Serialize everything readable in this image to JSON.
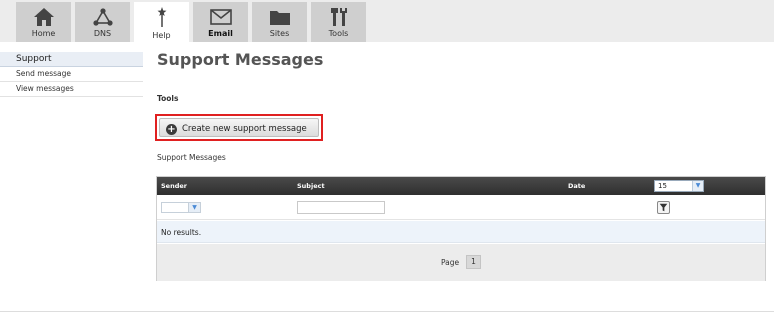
{
  "nav": {
    "tabs": [
      {
        "label": "Home",
        "icon": "home-icon"
      },
      {
        "label": "DNS",
        "icon": "network-icon"
      },
      {
        "label": "Help",
        "icon": "wand-icon"
      },
      {
        "label": "Email",
        "icon": "envelope-icon"
      },
      {
        "label": "Sites",
        "icon": "folder-icon"
      },
      {
        "label": "Tools",
        "icon": "tools-icon"
      }
    ],
    "active_tab": "Help"
  },
  "sidebar": {
    "header": "Support",
    "items": [
      {
        "label": "Send message"
      },
      {
        "label": "View messages"
      }
    ]
  },
  "main": {
    "title": "Support Messages",
    "tools_label": "Tools",
    "create_button_label": "Create new support message",
    "messages_label": "Support Messages",
    "grid": {
      "columns": [
        "Sender",
        "Subject",
        "Date"
      ],
      "page_size": "15",
      "empty_text": "No results.",
      "pager_label": "Page",
      "current_page": "1"
    }
  },
  "colors": {
    "highlight_border": "#e02020",
    "grid_header": "#3a3a3a",
    "row_highlight": "#edf3fa",
    "sidebar_header": "#e9eef5"
  }
}
